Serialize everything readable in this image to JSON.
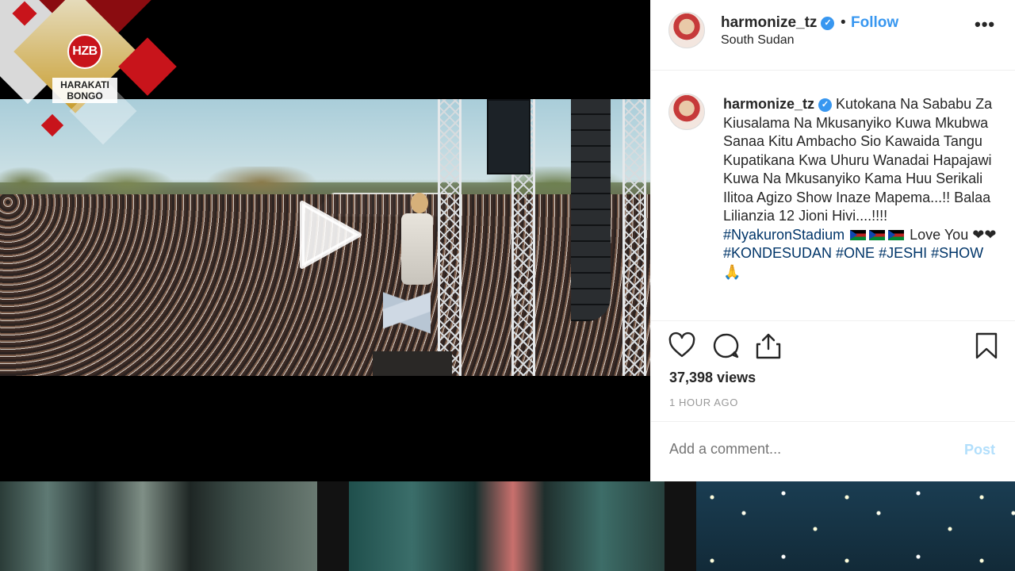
{
  "logo": {
    "badge": "HZB",
    "line1": "HARAKATI",
    "line2": "BONGO"
  },
  "header": {
    "username": "harmonize_tz",
    "separator": "•",
    "follow_label": "Follow",
    "location": "South Sudan",
    "more_label": "•••"
  },
  "caption": {
    "username": "harmonize_tz",
    "text": "Kutokana Na Sababu Za Kiusalama Na Mkusanyiko Kuwa Mkubwa Sanaa Kitu Ambacho Sio Kawaida Tangu Kupatikana Kwa Uhuru Wanadai Hapajawi Kuwa Na Mkusanyiko Kama Huu Serikali Ilitoa Agizo Show Inaze Mapema...!! Balaa Lilianzia 12 Jioni Hivi....!!!!",
    "hashtag1": "#NyakuronStadium",
    "love_text": "Love You",
    "hearts": "❤❤",
    "hashtag2": "#KONDESUDAN",
    "hashtag3": "#ONE",
    "hashtag4": "#JESHI",
    "hashtag5": "#SHOW",
    "pray": "🙏"
  },
  "stats": {
    "views": "37,398 views",
    "time_ago": "1 HOUR AGO"
  },
  "comment": {
    "placeholder": "Add a comment...",
    "post_label": "Post"
  },
  "icons": [
    "heart-icon",
    "comment-icon",
    "share-icon",
    "bookmark-icon",
    "play-icon",
    "verified-icon"
  ],
  "colors": {
    "link": "#3897f0",
    "hashtag": "#003569",
    "post_disabled": "#b2dffc",
    "brand_red": "#c8141b"
  }
}
